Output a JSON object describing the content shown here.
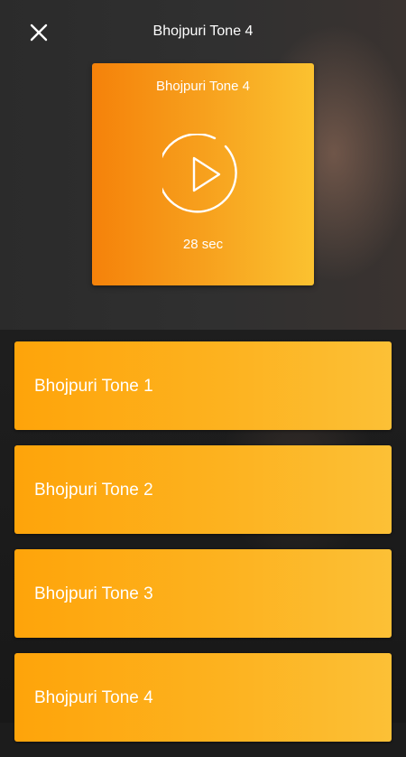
{
  "header": {
    "title": "Bhojpuri Tone 4"
  },
  "player": {
    "title": "Bhojpuri Tone 4",
    "duration": "28 sec"
  },
  "tones": [
    {
      "label": "Bhojpuri Tone 1"
    },
    {
      "label": "Bhojpuri Tone 2"
    },
    {
      "label": "Bhojpuri Tone 3"
    },
    {
      "label": "Bhojpuri Tone 4"
    }
  ],
  "icons": {
    "close": "close-icon",
    "play": "play-icon"
  },
  "colors": {
    "accent_start": "#f5820a",
    "accent_end": "#fbc230",
    "list_start": "#fea40a",
    "list_end": "#fcc036"
  }
}
